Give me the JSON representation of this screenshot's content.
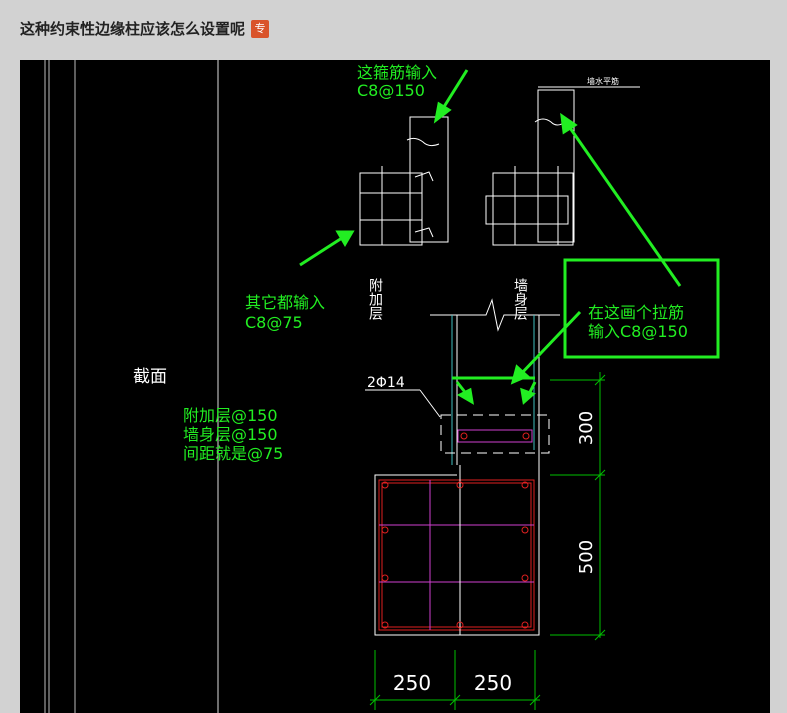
{
  "post": {
    "title": "这种约束性边缘柱应该怎么设置呢",
    "badge": "专"
  },
  "drawing": {
    "section_label": "截面",
    "stirrup_note_line1": "这箍筋输入",
    "stirrup_note_line2": "C8@150",
    "other_note_line1": "其它都输入",
    "other_note_line2": "C8@75",
    "tie_note_line1": "在这画个拉筋",
    "tie_note_line2": "输入C8@150",
    "spacing_line1": "附加层@150",
    "spacing_line2": "墙身层@150",
    "spacing_line3": "间距就是@75",
    "label_additional": "附加层",
    "label_wall": "墙身层",
    "label_small_top": "墙水平筋",
    "rebar_label": "2Φ14",
    "dim_300": "300",
    "dim_500": "500",
    "dim_250_left": "250",
    "dim_250_right": "250"
  },
  "colors": {
    "annotation_green": "#22ee22",
    "cad_white": "#ffffff",
    "cad_red": "#e02020",
    "cad_magenta": "#d040d0",
    "dim_green": "#00c000",
    "cad_cyan": "#40c0c0"
  }
}
